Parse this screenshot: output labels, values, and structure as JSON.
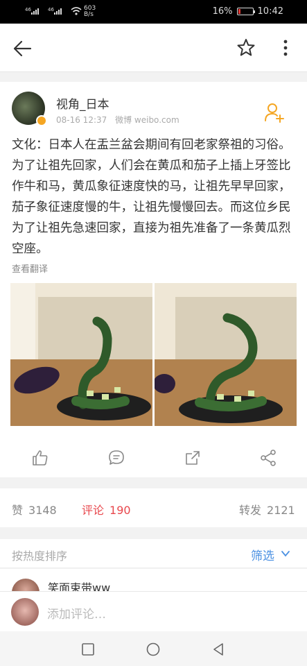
{
  "status_bar": {
    "network": "46",
    "speed": "603",
    "speed_unit": "B/s",
    "battery_text": "16%",
    "battery_level": 0.16,
    "time": "10:42"
  },
  "post": {
    "author": "视角_日本",
    "time": "08-16 12:37",
    "source": "微博 weibo.com",
    "content": "文化：日本人在盂兰盆会期间有回老家祭祖的习俗。为了让祖先回家，人们会在黄瓜和茄子上插上牙签比作牛和马，黄瓜象征速度快的马，让祖先早早回家，茄子象征速度慢的牛，让祖先慢慢回去。而这位乡民为了让祖先急速回家，直接为祖先准备了一条黄瓜烈空座。",
    "translate_label": "查看翻译"
  },
  "stats": {
    "likes_label": "赞",
    "likes": "3148",
    "comments_label": "评论",
    "comments": "190",
    "reposts_label": "转发",
    "reposts": "2121"
  },
  "sort": {
    "label": "按热度排序",
    "filter": "筛选"
  },
  "comment_preview": {
    "name": "笑面束带ww"
  },
  "comment_input": {
    "placeholder": "添加评论…"
  },
  "colors": {
    "accent_blue": "#4a90e2",
    "accent_red": "#e8474c",
    "verified": "#f5a623"
  }
}
